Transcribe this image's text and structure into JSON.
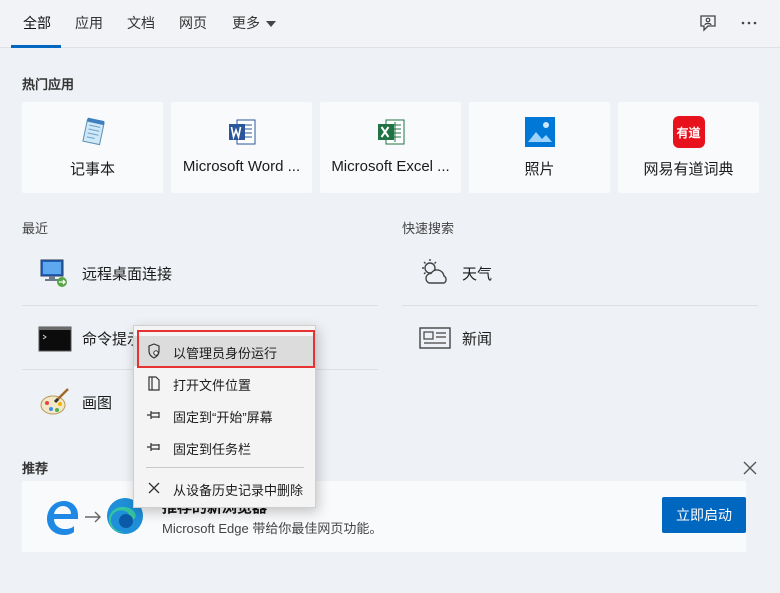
{
  "tabs": [
    "全部",
    "应用",
    "文档",
    "网页",
    "更多"
  ],
  "hot_apps": {
    "title": "热门应用",
    "items": [
      {
        "label": "记事本",
        "icon": "notepad-icon"
      },
      {
        "label": "Microsoft Word ...",
        "icon": "word-icon"
      },
      {
        "label": "Microsoft Excel ...",
        "icon": "excel-icon"
      },
      {
        "label": "照片",
        "icon": "photos-icon"
      },
      {
        "label": "网易有道词典",
        "icon": "youdao-icon"
      }
    ],
    "youdao_icon_text": "有道"
  },
  "recent": {
    "title": "最近",
    "items": [
      {
        "label": "远程桌面连接",
        "icon": "remote-desktop-icon"
      },
      {
        "label": "命令提示",
        "icon": "command-prompt-icon"
      },
      {
        "label": "画图",
        "icon": "paint-icon"
      }
    ]
  },
  "quick_search": {
    "title": "快速搜索",
    "items": [
      {
        "label": "天气",
        "icon": "weather-icon"
      },
      {
        "label": "新闻",
        "icon": "news-icon"
      }
    ]
  },
  "recommend": {
    "title": "推荐",
    "headline": "推荐的新浏览器",
    "subtitle": "Microsoft Edge 带给你最佳网页功能。",
    "button": "立即启动"
  },
  "context_menu": {
    "items": [
      {
        "label": "以管理员身份运行",
        "icon": "shield-icon"
      },
      {
        "label": "打开文件位置",
        "icon": "folder-icon"
      },
      {
        "label": "固定到“开始”屏幕",
        "icon": "pin-icon"
      },
      {
        "label": "固定到任务栏",
        "icon": "pin-icon"
      },
      {
        "label": "从设备历史记录中删除",
        "icon": "delete-icon"
      }
    ]
  },
  "colors": {
    "accent": "#0067c0",
    "highlight_border": "#e63232"
  }
}
